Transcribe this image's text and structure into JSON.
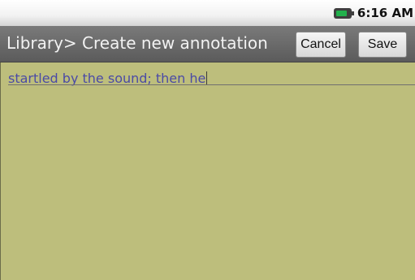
{
  "status": {
    "time": "6:16 AM",
    "battery_icon": "battery-icon"
  },
  "header": {
    "title": "Library> Create new annotation",
    "cancel_label": "Cancel",
    "save_label": "Save"
  },
  "editor": {
    "text": "startled by the sound; then he"
  },
  "colors": {
    "title_bar": "#5b5b5b",
    "note_background": "#bdbe7c",
    "note_text": "#4a4aa6"
  }
}
